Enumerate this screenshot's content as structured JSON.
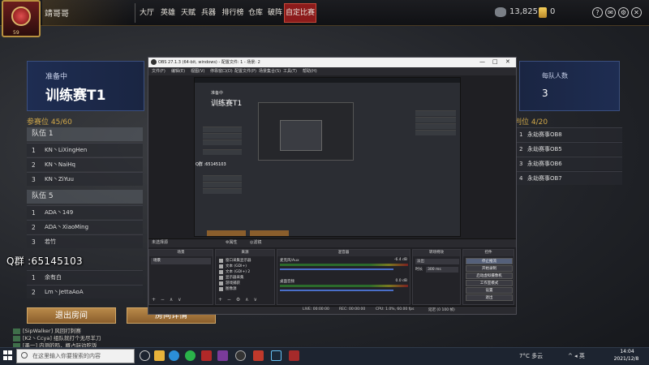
{
  "game": {
    "player_name": "靖哥哥",
    "level": "59",
    "nav": [
      "大厅",
      "英雄",
      "天赋",
      "兵器",
      "排行榜",
      "仓库",
      "破阵",
      "自定比赛"
    ],
    "coins": "13,825",
    "gold": "0",
    "top_icons": [
      "?",
      "✉",
      "⚙",
      "✕"
    ]
  },
  "lobby": {
    "status": "准备中",
    "room_name": "训练赛T1",
    "slots_label": "参赛位 45/60",
    "teams": [
      {
        "name": "队伍 1",
        "players": [
          {
            "num": "1",
            "name": "KN丶LiXingHen"
          },
          {
            "num": "2",
            "name": "KN丶NaiHq"
          },
          {
            "num": "3",
            "name": "KN丶ZiYuu"
          }
        ]
      },
      {
        "name": "队伍 5",
        "players": [
          {
            "num": "1",
            "name": "ADA丶149"
          },
          {
            "num": "2",
            "name": "ADA丶XiaoMing"
          },
          {
            "num": "3",
            "name": "若竹"
          }
        ]
      }
    ],
    "extra_rows": [
      {
        "num": "1",
        "name": "余有白"
      },
      {
        "num": "2",
        "name": "Lm丶JettaAoA"
      }
    ],
    "team_size_label": "每队人数",
    "team_size": "3",
    "bench_label": "判位 4/20",
    "bench": [
      {
        "num": "1",
        "name": "永劫赛事OB8"
      },
      {
        "num": "2",
        "name": "永劫赛事OB5"
      },
      {
        "num": "3",
        "name": "永劫赛事OB6"
      },
      {
        "num": "4",
        "name": "永劫赛事OB7"
      }
    ],
    "exit_label": "退出房间",
    "detail_label": "房间详情",
    "qq_overlay": "Q群 :65145103"
  },
  "chat": [
    {
      "text": "[SipWalker] 风回打刺赛"
    },
    {
      "text": "[K2丶Ccya] 组队就打个无尽羊刀"
    },
    {
      "text": "[墨一] 内测的吗，概占玩边吃饭"
    }
  ],
  "obs": {
    "title": "OBS 27.1.3 (64-bit, windows) - 配置文件: 1 - 场景: 2",
    "menu": [
      "文件(F)",
      "编辑(E)",
      "视图(V)",
      "停靠窗口(D)",
      "配置文件(P)",
      "场景集合(S)",
      "工具(T)",
      "帮助(H)"
    ],
    "preview_status": "准备中",
    "preview_room": "训练赛T1",
    "preview_qq": "Q群 :65145103",
    "no_source": "未选择源",
    "props": "⚙属性",
    "filters": "◎滤镜",
    "docks": {
      "scenes": "场景",
      "sources": "来源",
      "mixer": "混音器",
      "transitions": "转场特效",
      "controls": "控件"
    },
    "scene_item": "场景",
    "sources": [
      "窗口采集显示器",
      "文本 (GDI+)",
      "文本 (GDI+) 2",
      "显示器采集",
      "游戏捕获",
      "图像源"
    ],
    "mixer": [
      {
        "name": "麦克风/Aux",
        "db": "-6.4 dB"
      },
      {
        "name": "桌面音频",
        "db": "0.0 dB"
      }
    ],
    "transition": {
      "type": "淡出",
      "duration_label": "时长",
      "duration": "300 ms"
    },
    "controls": [
      "停止推流",
      "开始录制",
      "启动虚拟摄像机",
      "工作室模式",
      "设置",
      "退出"
    ],
    "status": [
      "LIVE: 00:00:00",
      "REC: 00:00:00",
      "CPU: 1.0%, 60.00 fps",
      "延迟 (0 100 帧)"
    ]
  },
  "taskbar": {
    "search_placeholder": "在这里输入你要搜索的内容",
    "weather": "7°C 多云",
    "tray": "^ ◂ 英",
    "time": "14:04",
    "date": "2021/12/8"
  }
}
